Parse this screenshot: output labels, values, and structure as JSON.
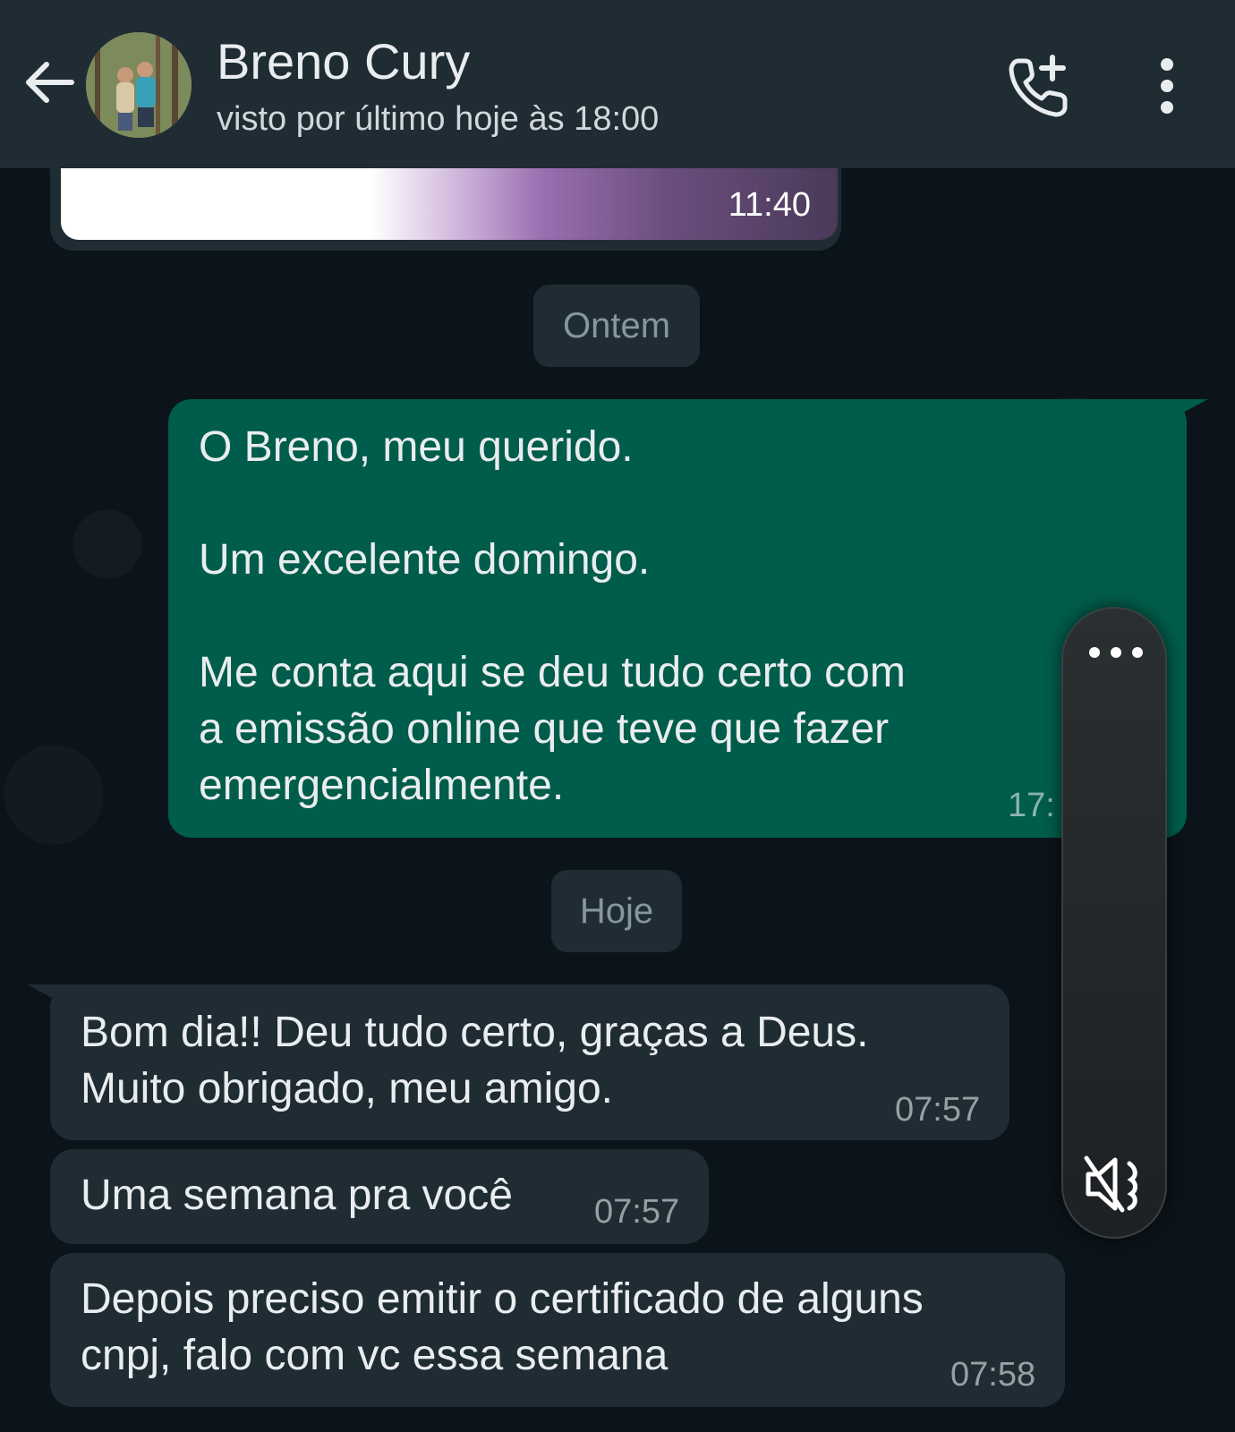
{
  "header": {
    "contact_name": "Breno Cury",
    "status": "visto por último hoje às 18:00",
    "icons": [
      "arrow-left-icon",
      "avatar",
      "phone-add-icon",
      "more-vert-icon"
    ]
  },
  "messages": {
    "image_time": "11:40",
    "date_yesterday": "Ontem",
    "date_today": "Hoje",
    "out_1": {
      "text": "O Breno, meu querido.\n\nUm excelente domingo.\n\nMe conta aqui se deu tudo certo com\na emissão online que teve que fazer\nemergencialmente.",
      "time": "17:"
    },
    "in_1": {
      "text": "Bom dia!! Deu tudo certo,  graças a Deus.\nMuito obrigado,  meu amigo.",
      "time": "07:57"
    },
    "in_2": {
      "text": "Uma semana pra você",
      "time": "07:57"
    },
    "in_3": {
      "text": "Depois preciso emitir o certificado de alguns\ncnpj,  falo com vc essa semana",
      "time": "07:58"
    }
  },
  "side_panel": {
    "icons": [
      "more-horiz-icon",
      "volume-mute-icon"
    ]
  },
  "colors": {
    "header_bg": "#1f2c34",
    "chat_bg": "#0b141a",
    "outgoing_bubble": "#005c4b",
    "incoming_bubble": "#1f2c34"
  }
}
